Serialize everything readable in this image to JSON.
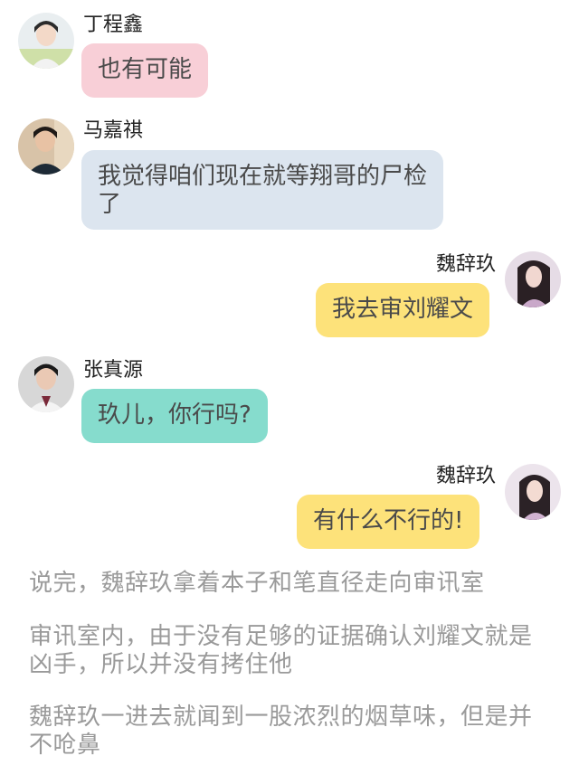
{
  "colors": {
    "pink": "#f8cfd7",
    "blue": "#dce5ef",
    "yellow": "#fde27a",
    "teal": "#86dccd",
    "narration": "#9a9a9a"
  },
  "messages": [
    {
      "speaker": "丁程鑫",
      "text": "也有可能",
      "side": "left",
      "bubble_color": "pink",
      "avatar": "avatar-ding"
    },
    {
      "speaker": "马嘉祺",
      "text": "我觉得咱们现在就等翔哥的尸检了",
      "side": "left",
      "bubble_color": "blue",
      "avatar": "avatar-ma"
    },
    {
      "speaker": "魏辞玖",
      "text": "我去审刘耀文",
      "side": "right",
      "bubble_color": "yellow",
      "avatar": "avatar-wei"
    },
    {
      "speaker": "张真源",
      "text": "玖儿，你行吗?",
      "side": "left",
      "bubble_color": "teal",
      "avatar": "avatar-zhang"
    },
    {
      "speaker": "魏辞玖",
      "text": "有什么不行的!",
      "side": "right",
      "bubble_color": "yellow",
      "avatar": "avatar-wei"
    }
  ],
  "narration": [
    "说完，魏辞玖拿着本子和笔直径走向审讯室",
    "审讯室内，由于没有足够的证据确认刘耀文就是凶手，所以并没有拷住他",
    "魏辞玖一进去就闻到一股浓烈的烟草味，但是并不呛鼻"
  ]
}
